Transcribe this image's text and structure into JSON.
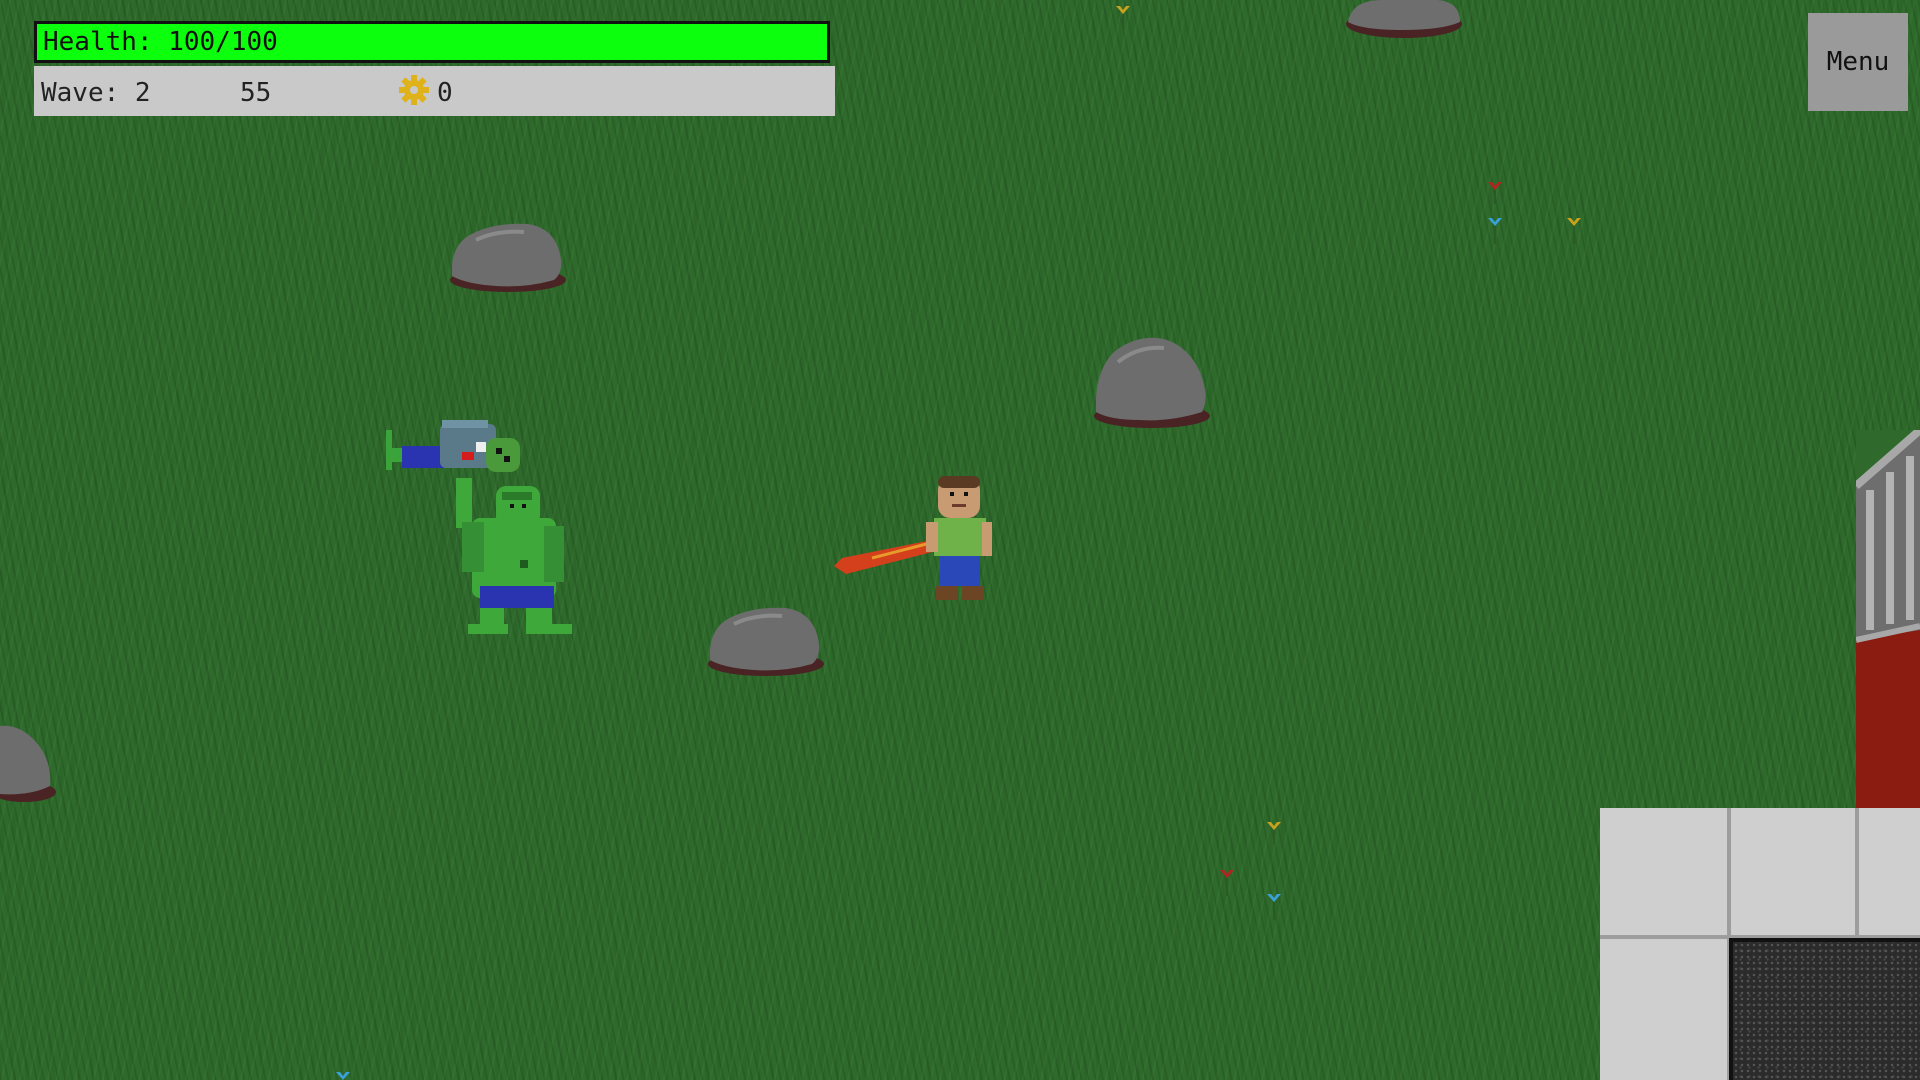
{
  "hud": {
    "health_label": "Health: 100/100",
    "health_current": 100,
    "health_max": 100,
    "wave_label": "Wave: 2",
    "score": "55",
    "gear_count": "0",
    "gear_icon": "gear-icon",
    "health_color": "#0cff0c"
  },
  "menu": {
    "label": "Menu"
  },
  "scene": {
    "ground": "grass",
    "entities": [
      "player-with-bat",
      "ogre-holding-zombie",
      "rocks",
      "flowers",
      "stone-floor",
      "building-wall"
    ]
  }
}
